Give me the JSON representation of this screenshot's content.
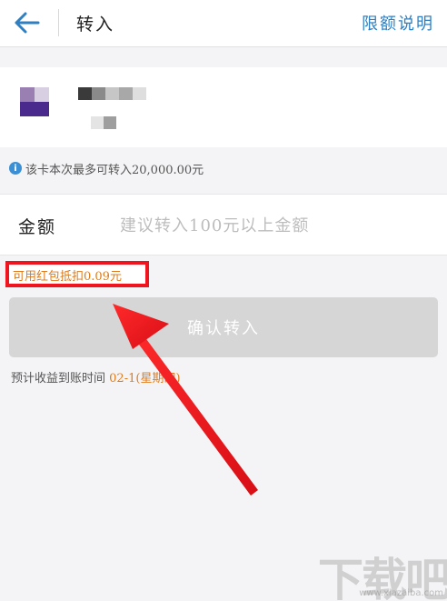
{
  "header": {
    "back_icon": "arrow-left-icon",
    "title": "转入",
    "limit_link": "限额说明"
  },
  "card": {
    "logo_colors": [
      "#9a7fb3",
      "#d9cfe2",
      "#4a2a8c"
    ],
    "name_masked": true,
    "number_masked": true
  },
  "info": {
    "icon": "info-icon",
    "text": "该卡本次最多可转入20,000.00元"
  },
  "amount": {
    "label": "金额",
    "value": "",
    "placeholder": "建议转入100元以上金额"
  },
  "red_packet": {
    "text": "可用红包抵扣0.09元"
  },
  "confirm": {
    "label": "确认转入"
  },
  "arrival": {
    "label": "预计收益到账时间",
    "date": "02-1",
    "weekday": "(星期四)"
  },
  "watermark": {
    "logo_text": "下载吧",
    "site": "www.xiazaiba.com"
  },
  "colors": {
    "accent_blue": "#2f7fc1",
    "highlight_red": "#f0141e",
    "orange_text": "#e07b1a"
  }
}
